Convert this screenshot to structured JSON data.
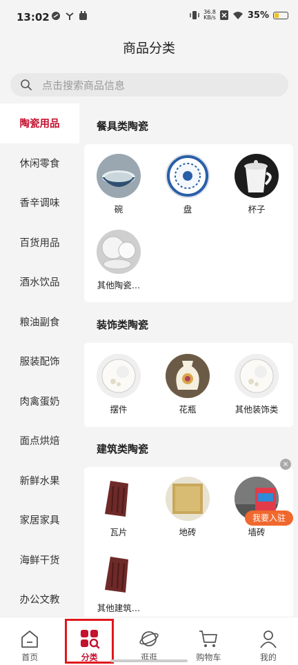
{
  "status_bar": {
    "time": "13:02",
    "net_speed_value": "36.8",
    "net_speed_unit": "KB/s",
    "battery": "35%",
    "battery_level": 0.35
  },
  "header": {
    "title": "商品分类"
  },
  "search": {
    "placeholder": "点击搜索商品信息"
  },
  "sidebar": {
    "items": [
      {
        "label": "陶瓷用品",
        "active": true
      },
      {
        "label": "休闲零食"
      },
      {
        "label": "香辛调味"
      },
      {
        "label": "百货用品"
      },
      {
        "label": "酒水饮品"
      },
      {
        "label": "粮油副食"
      },
      {
        "label": "服装配饰"
      },
      {
        "label": "肉禽蛋奶"
      },
      {
        "label": "面点烘焙"
      },
      {
        "label": "新鲜水果"
      },
      {
        "label": "家居家具"
      },
      {
        "label": "海鲜干货"
      },
      {
        "label": "办公文教"
      }
    ]
  },
  "sections": [
    {
      "title": "餐具类陶瓷",
      "items": [
        {
          "label": "碗",
          "icon": "bowl-image"
        },
        {
          "label": "盘",
          "icon": "plate-image"
        },
        {
          "label": "杯子",
          "icon": "cup-image"
        },
        {
          "label": "其他陶瓷…",
          "icon": "ceramics-set-image"
        }
      ]
    },
    {
      "title": "装饰类陶瓷",
      "items": [
        {
          "label": "摆件",
          "icon": "ornament-image"
        },
        {
          "label": "花瓶",
          "icon": "vase-image"
        },
        {
          "label": "其他装饰类",
          "icon": "ornament-image"
        }
      ]
    },
    {
      "title": "建筑类陶瓷",
      "items": [
        {
          "label": "瓦片",
          "icon": "roof-tile-image"
        },
        {
          "label": "地砖",
          "icon": "floor-tile-image"
        },
        {
          "label": "墙砖",
          "icon": "wall-tile-image"
        },
        {
          "label": "其他建筑…",
          "icon": "roof-tile-image"
        }
      ]
    }
  ],
  "floating": {
    "badge": "我要入驻",
    "close": "×"
  },
  "tabbar": {
    "tabs": [
      {
        "label": "首页",
        "icon": "home-icon"
      },
      {
        "label": "分类",
        "icon": "category-icon",
        "active": true
      },
      {
        "label": "逛逛",
        "icon": "planet-icon"
      },
      {
        "label": "购物车",
        "icon": "cart-icon"
      },
      {
        "label": "我的",
        "icon": "profile-icon"
      }
    ]
  },
  "colors": {
    "accent": "#c4122f",
    "badge": "#f0682d"
  }
}
